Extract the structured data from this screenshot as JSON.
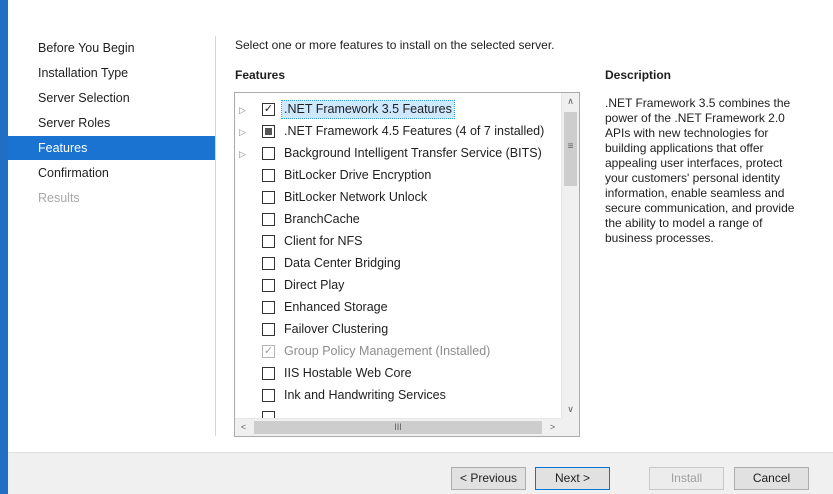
{
  "nav": {
    "items": [
      {
        "label": "Before You Begin",
        "state": "normal"
      },
      {
        "label": "Installation Type",
        "state": "normal"
      },
      {
        "label": "Server Selection",
        "state": "normal"
      },
      {
        "label": "Server Roles",
        "state": "normal"
      },
      {
        "label": "Features",
        "state": "active"
      },
      {
        "label": "Confirmation",
        "state": "normal"
      },
      {
        "label": "Results",
        "state": "disabled"
      }
    ]
  },
  "main": {
    "intro": "Select one or more features to install on the selected server.",
    "features_heading": "Features",
    "description_heading": "Description",
    "description_text": ".NET Framework 3.5 combines the power of the .NET Framework 2.0 APIs with new technologies for building applications that offer appealing user interfaces, protect your customers' personal identity information, enable seamless and secure communication, and provide the ability to model a range of business processes."
  },
  "features": [
    {
      "label": ".NET Framework 3.5 Features",
      "expandable": true,
      "check": "checked",
      "selected": true,
      "disabled": false
    },
    {
      "label": ".NET Framework 4.5 Features (4 of 7 installed)",
      "expandable": true,
      "check": "partial",
      "selected": false,
      "disabled": false
    },
    {
      "label": "Background Intelligent Transfer Service (BITS)",
      "expandable": true,
      "check": "unchecked",
      "selected": false,
      "disabled": false
    },
    {
      "label": "BitLocker Drive Encryption",
      "expandable": false,
      "check": "unchecked",
      "selected": false,
      "disabled": false
    },
    {
      "label": "BitLocker Network Unlock",
      "expandable": false,
      "check": "unchecked",
      "selected": false,
      "disabled": false
    },
    {
      "label": "BranchCache",
      "expandable": false,
      "check": "unchecked",
      "selected": false,
      "disabled": false
    },
    {
      "label": "Client for NFS",
      "expandable": false,
      "check": "unchecked",
      "selected": false,
      "disabled": false
    },
    {
      "label": "Data Center Bridging",
      "expandable": false,
      "check": "unchecked",
      "selected": false,
      "disabled": false
    },
    {
      "label": "Direct Play",
      "expandable": false,
      "check": "unchecked",
      "selected": false,
      "disabled": false
    },
    {
      "label": "Enhanced Storage",
      "expandable": false,
      "check": "unchecked",
      "selected": false,
      "disabled": false
    },
    {
      "label": "Failover Clustering",
      "expandable": false,
      "check": "unchecked",
      "selected": false,
      "disabled": false
    },
    {
      "label": "Group Policy Management (Installed)",
      "expandable": false,
      "check": "checked",
      "selected": false,
      "disabled": true
    },
    {
      "label": "IIS Hostable Web Core",
      "expandable": false,
      "check": "unchecked",
      "selected": false,
      "disabled": false
    },
    {
      "label": "Ink and Handwriting Services",
      "expandable": false,
      "check": "unchecked",
      "selected": false,
      "disabled": false
    }
  ],
  "scrollbar": {
    "grip_v": "≡",
    "grip_h": "III",
    "up": "∧",
    "down": "∨",
    "left": "<",
    "right": ">"
  },
  "footer": {
    "previous": "< Previous",
    "next": "Next >",
    "install": "Install",
    "cancel": "Cancel"
  },
  "icons": {
    "expander": "expand-arrow-icon",
    "check": "checkmark-icon"
  },
  "colors": {
    "accent": "#1a73d1",
    "window_border": "#1f6fc4",
    "selection": "#cde8ff"
  }
}
